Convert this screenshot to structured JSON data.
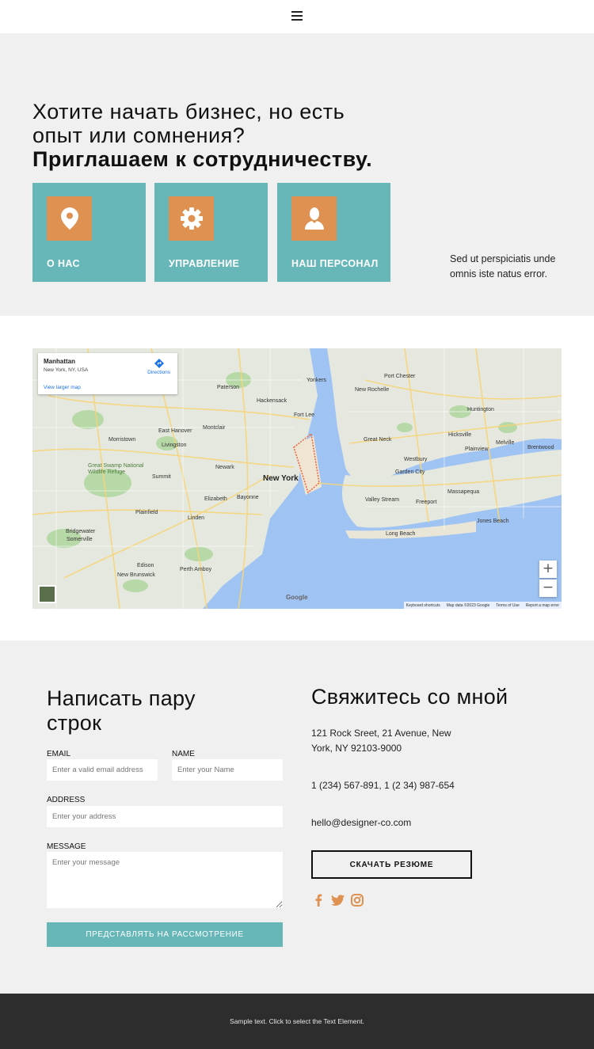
{
  "header": {
    "menu_icon": "hamburger-icon"
  },
  "hero": {
    "title_line1": "Хотите начать бизнес, но есть",
    "title_line2": "опыт или сомнения?",
    "title_bold": "Приглашаем к сотрудничеству.",
    "cards": [
      {
        "label": "О НАС",
        "icon": "location-pin-icon"
      },
      {
        "label": "УПРАВЛЕНИЕ",
        "icon": "gear-icon"
      },
      {
        "label": "НАШ ПЕРСОНАЛ",
        "icon": "person-icon"
      }
    ],
    "side_text": "Sed ut perspiciatis unde omnis iste natus error.",
    "card_bg": "#67b7b9",
    "icon_bg": "#de9150",
    "section_bg": "#f0f0f0"
  },
  "map": {
    "info_place": "Manhattan",
    "info_address": "New York, NY, USA",
    "directions": "Directions",
    "view_larger": "View larger map",
    "zoom_in": "+",
    "zoom_out": "−",
    "google": "Google",
    "footer_links": [
      "Keyboard shortcuts",
      "Map data ©2023 Google",
      "Terms of Use",
      "Report a map error"
    ],
    "place_labels": {
      "new_york": "New York",
      "newark": "Newark",
      "yonkers": "Yonkers",
      "paterson": "Paterson",
      "hackensack": "Hackensack",
      "elizabeth": "Elizabeth",
      "bayonne": "Bayonne",
      "edison": "Edison",
      "plainfield": "Plainfield",
      "morristown": "Morristown",
      "summit": "Summit",
      "livingston": "Livingston",
      "montclair": "Montclair",
      "new_rochelle": "New Rochelle",
      "great_neck": "Great Neck",
      "hicksville": "Hicksville",
      "huntington": "Huntington",
      "freeport": "Freeport",
      "long_beach": "Long Beach",
      "massapequa": "Massapequa",
      "valley_stream": "Valley Stream",
      "perth_amboy": "Perth Amboy",
      "new_brunswick": "New Brunswick",
      "somerville": "Somerville",
      "bridgewater": "Bridgewater",
      "jones_beach": "Jones Beach",
      "westbury": "Westbury",
      "garden_city": "Garden City",
      "plainview": "Plainview",
      "brentwood": "Brentwood",
      "linden": "Linden",
      "east_hanover": "East Hanover",
      "great_swamp": "Great Swamp National Wildlife Refuge",
      "fort_lee": "Fort Lee",
      "port_chester": "Port Chester",
      "melville": "Melville"
    }
  },
  "contact": {
    "form_title": "Написать пару строк",
    "email_label": "EMAIL",
    "email_placeholder": "Enter a valid email address",
    "name_label": "NAME",
    "name_placeholder": "Enter your Name",
    "address_label": "ADDRESS",
    "address_placeholder": "Enter your address",
    "message_label": "MESSAGE",
    "message_placeholder": "Enter your message",
    "submit_label": "ПРЕДСТАВЛЯТЬ НА РАССМОТРЕНИЕ",
    "info_title": "Свяжитесь со мной",
    "address": "121 Rock Sreet, 21 Avenue, New York, NY 92103-9000",
    "phones": "1 (234) 567-891, 1 (2 34) 987-654",
    "email": "hello@designer-co.com",
    "resume_label": "СКАЧАТЬ РЕЗЮМЕ",
    "social_icons": [
      "facebook-icon",
      "twitter-icon",
      "instagram-icon"
    ],
    "social_color": "#de9150"
  },
  "footer": {
    "text": "Sample text. Click to select the Text Element."
  }
}
